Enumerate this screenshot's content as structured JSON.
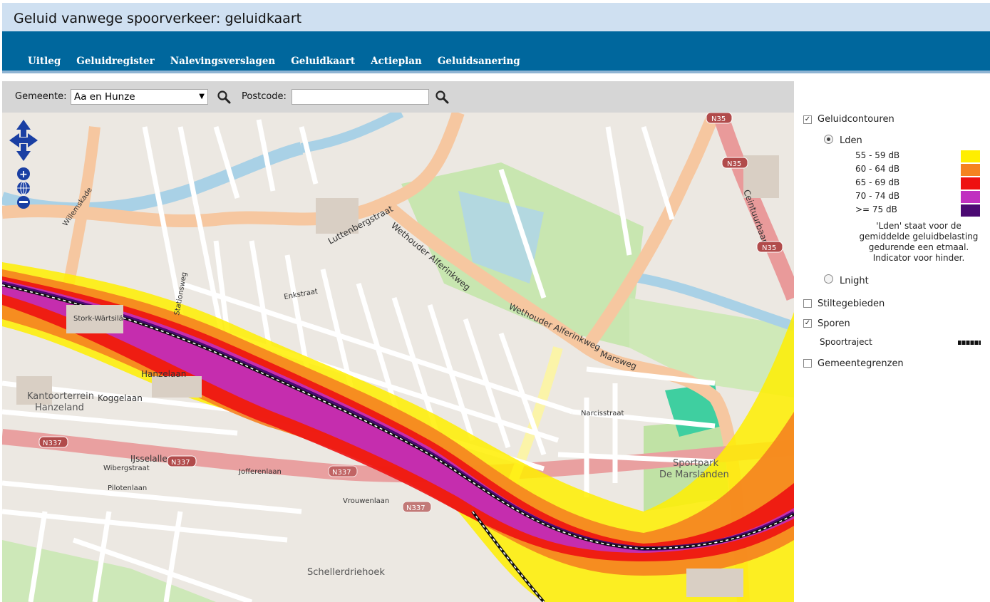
{
  "title": "Geluid vanwege spoorverkeer: geluidkaart",
  "nav": [
    "Uitleg",
    "Geluidregister",
    "Nalevingsverslagen",
    "Geluidkaart",
    "Actieplan",
    "Geluidsanering"
  ],
  "search": {
    "gemeente_label": "Gemeente:",
    "gemeente_value": "Aa en Hunze",
    "postcode_label": "Postcode:",
    "postcode_value": ""
  },
  "legend": {
    "geluidcontouren": "Geluidcontouren",
    "lden": "Lden",
    "bands": [
      {
        "label": "55 - 59 dB",
        "color": "#ffee00"
      },
      {
        "label": "60 - 64 dB",
        "color": "#f58220"
      },
      {
        "label": "65 - 69 dB",
        "color": "#ee1111"
      },
      {
        "label": "70 - 74 dB",
        "color": "#c030c0"
      },
      {
        "label": ">= 75 dB",
        "color": "#4b0a73"
      }
    ],
    "note": "'Lden' staat voor de gemiddelde geluidbelasting gedurende een etmaal. Indicator voor hinder.",
    "lnight": "Lnight",
    "stiltegebieden": "Stiltegebieden",
    "sporen": "Sporen",
    "spoortraject": "Spoortraject",
    "gemeentegrenzen": "Gemeentegrenzen"
  },
  "map": {
    "labels": {
      "luttenbergstraat": "Luttenbergstraat",
      "wethouder1": "Wethouder Alferinkweg",
      "wethouder2": "Wethouder Alferinkweg",
      "marsweg": "Marsweg",
      "hanzelaan": "Hanzelaan",
      "koggelaan": "Koggelaan",
      "ijsselallee": "IJsselallee",
      "joferenlaan": "Jofferenlaan",
      "pilotenlaan": "Pilotenlaan",
      "kantoorterrein": "Kantoorterrein",
      "hanzeland": "Hanzeland",
      "sportpark": "Sportpark",
      "marslanden": "De Marslanden",
      "schellerdriehoek": "Schellerdriehoek",
      "stationsweg": "Stationsweg",
      "willemskade": "Willemskade",
      "ceintuurbaan": "Ceintuurbaan",
      "stork": "Stork-Wärtsilä",
      "enkstraat": "Enkstraat",
      "narcisstraat": "Narcisstraat",
      "vrouwenlaan": "Vrouwenlaan",
      "wibergstraat": "Wibergstraat"
    },
    "shields": [
      "N35",
      "N35",
      "N35",
      "N337",
      "N337",
      "N337",
      "N337"
    ]
  }
}
